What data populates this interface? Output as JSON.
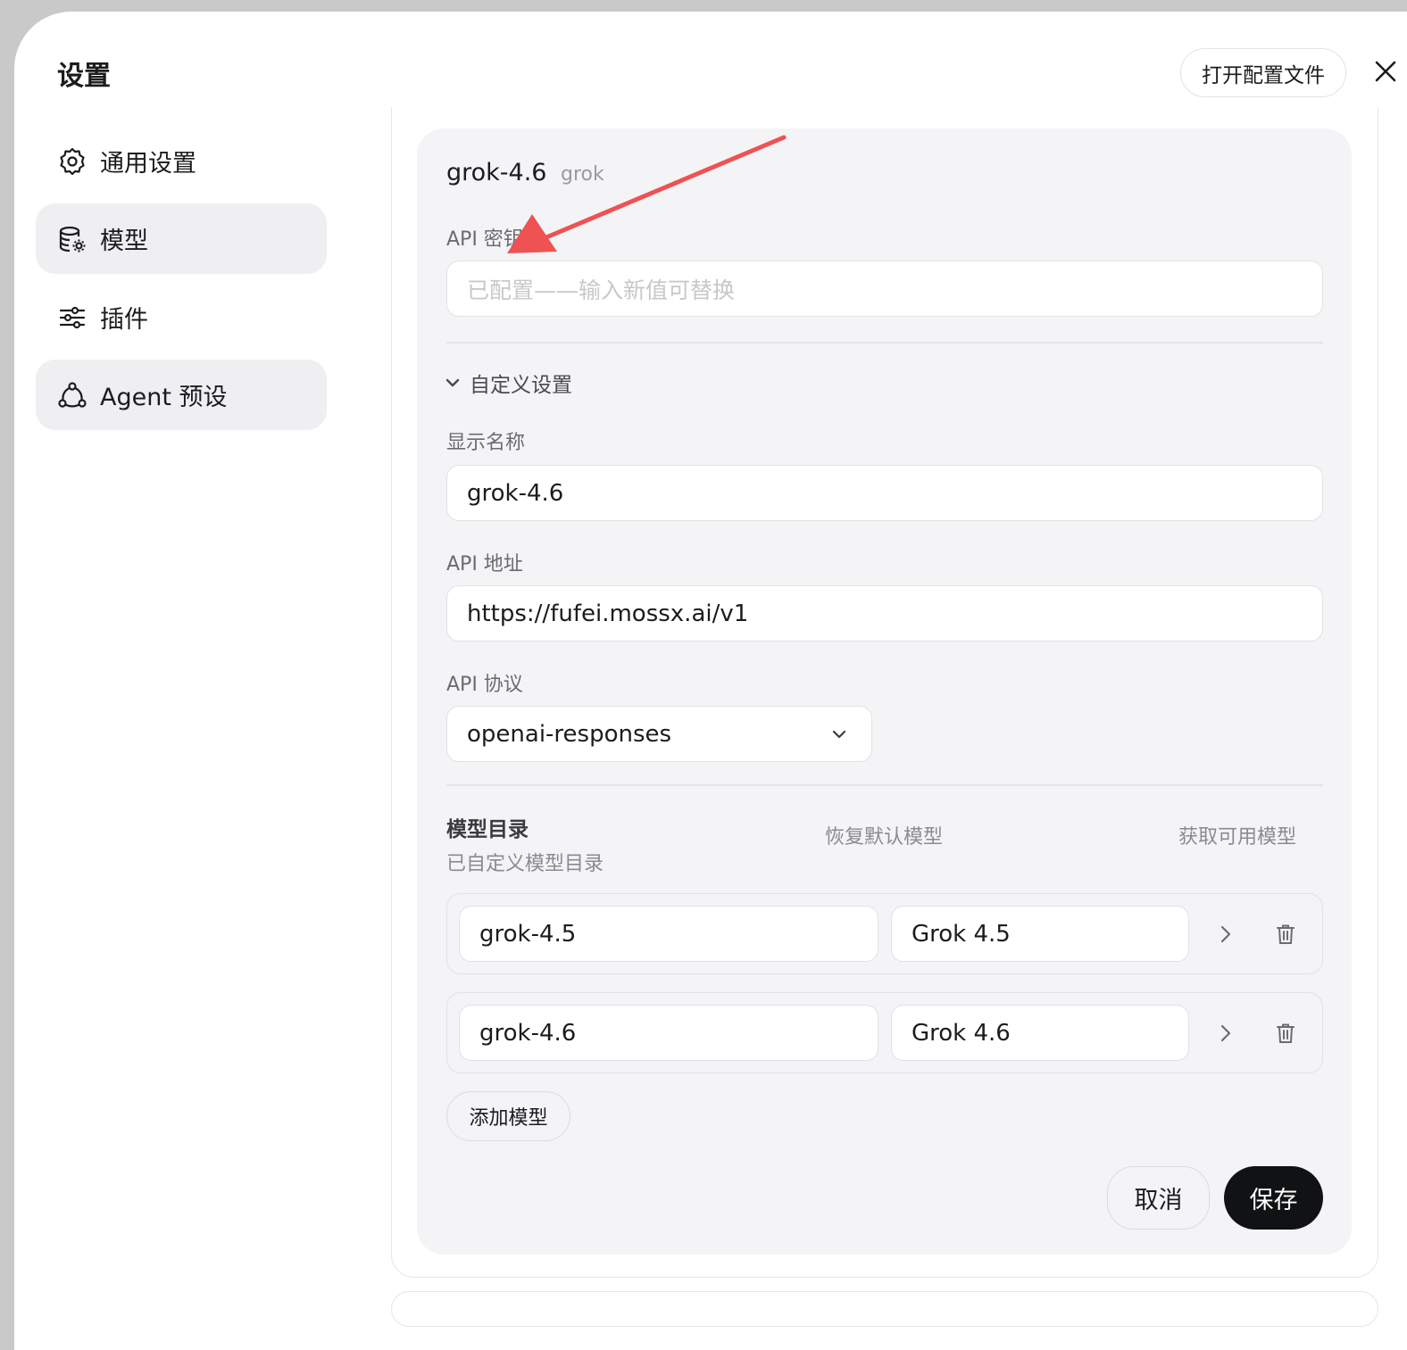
{
  "window": {
    "title": "设置",
    "open_config_label": "打开配置文件"
  },
  "sidebar": {
    "items": [
      {
        "label": "通用设置",
        "icon": "gear-icon",
        "active": false
      },
      {
        "label": "模型",
        "icon": "database-gear-icon",
        "active": true
      },
      {
        "label": "插件",
        "icon": "sliders-icon",
        "active": false
      },
      {
        "label": "Agent 预设",
        "icon": "agent-nodes-icon",
        "active": false
      }
    ]
  },
  "model": {
    "name": "grok-4.6",
    "provider": "grok",
    "api_key_label": "API 密钥",
    "api_key_placeholder": "已配置——输入新值可替换",
    "custom_section_label": "自定义设置",
    "display_name_label": "显示名称",
    "display_name_value": "grok-4.6",
    "api_url_label": "API 地址",
    "api_url_value": "https://fufei.mossx.ai/v1",
    "api_protocol_label": "API 协议",
    "api_protocol_value": "openai-responses"
  },
  "catalog": {
    "title": "模型目录",
    "subtitle": "已自定义模型目录",
    "restore_label": "恢复默认模型",
    "fetch_label": "获取可用模型",
    "rows": [
      {
        "id": "grok-4.5",
        "display": "Grok 4.5"
      },
      {
        "id": "grok-4.6",
        "display": "Grok 4.6"
      }
    ],
    "add_label": "添加模型"
  },
  "actions": {
    "cancel_label": "取消",
    "save_label": "保存"
  },
  "colors": {
    "accent_dark": "#111214",
    "annotation_arrow": "#ee5253",
    "card_bg": "#f4f4f6"
  }
}
